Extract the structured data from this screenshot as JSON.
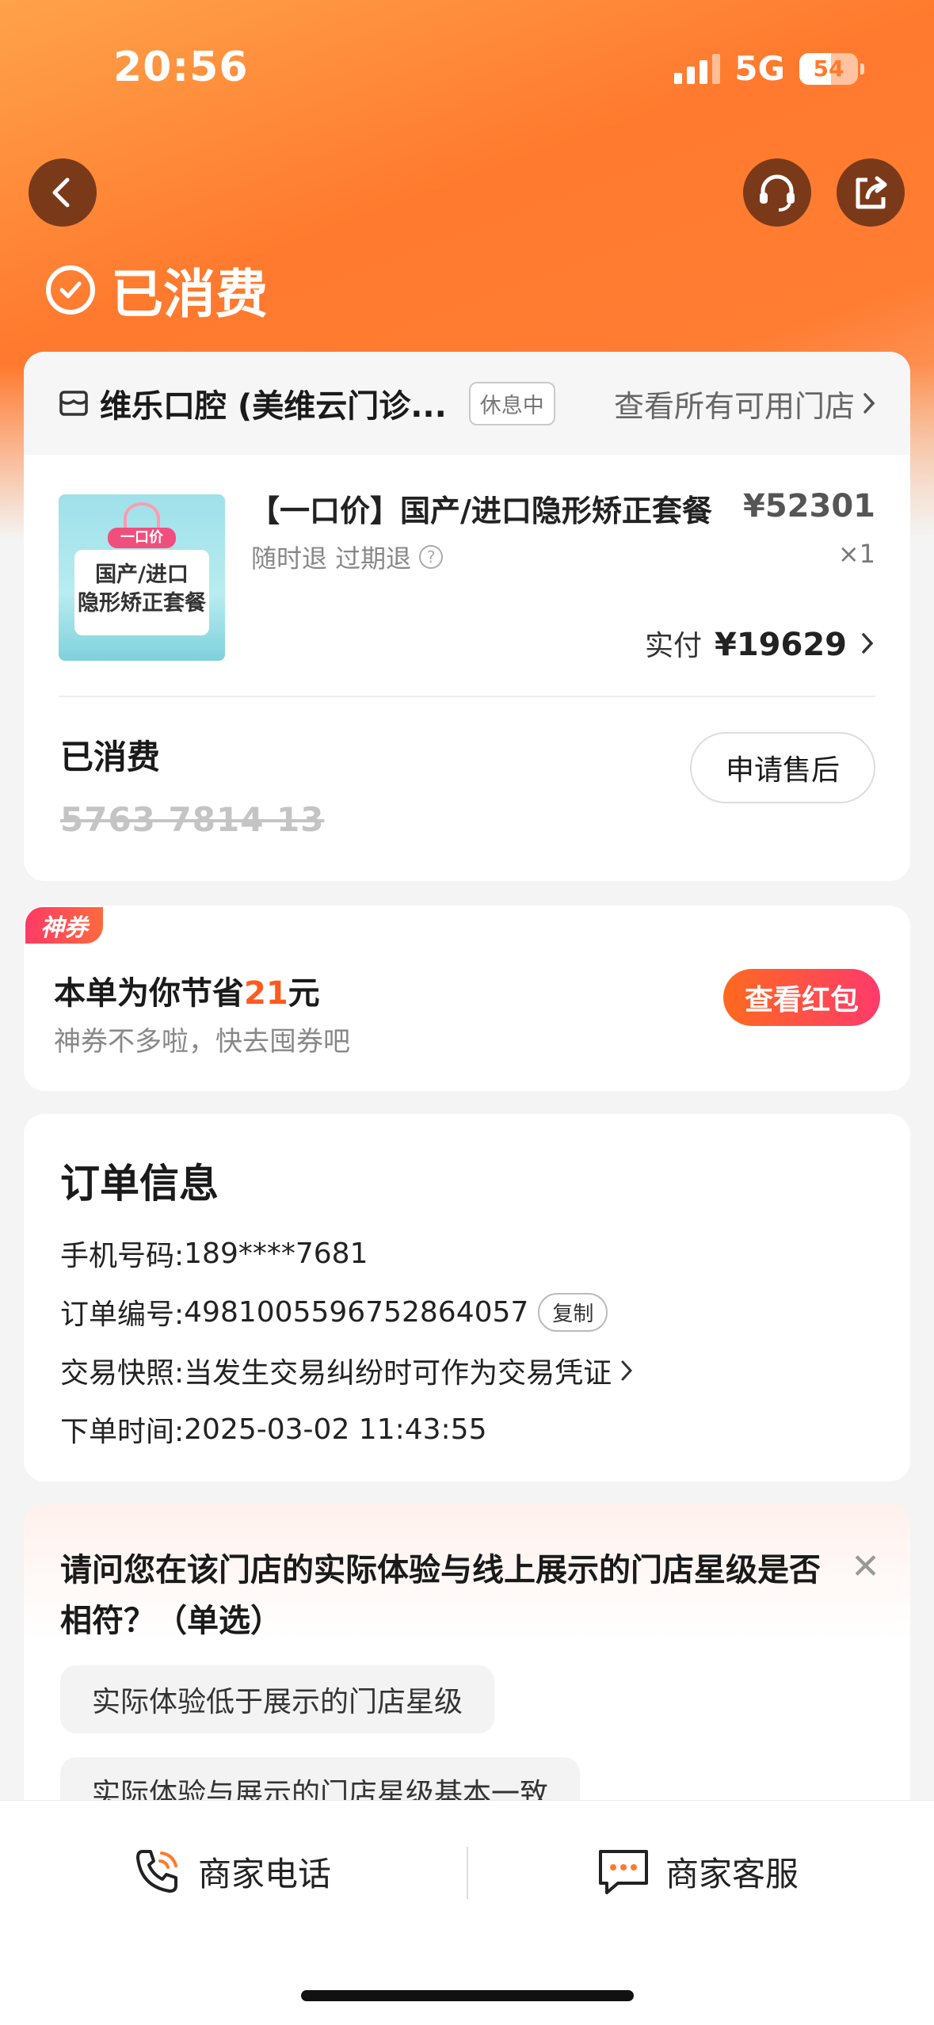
{
  "status_bar": {
    "time": "20:56",
    "network": "5G",
    "battery": "54"
  },
  "header": {
    "status_title": "已消费"
  },
  "store": {
    "name": "维乐口腔 (美维云门诊...",
    "badge": "休息中",
    "link": "查看所有可用门店"
  },
  "product": {
    "thumb_tag": "一口价",
    "thumb_line1": "国产/进口",
    "thumb_line2": "隐形矫正套餐",
    "title": "【一口价】国产/进口隐形矫正套餐",
    "price": "¥52301",
    "sub": "随时退 过期退",
    "qty": "×1",
    "paid_label": "实付",
    "paid_amount": "¥19629"
  },
  "voucher": {
    "label": "已消费",
    "code": "5763 7814 13",
    "after_sale": "申请售后"
  },
  "coupon": {
    "tag": "神券",
    "main_prefix": "本单为你节省",
    "main_amount": "21",
    "main_suffix": "元",
    "sub": "神券不多啦，快去囤券吧",
    "button": "查看红包"
  },
  "order_info": {
    "title": "订单信息",
    "phone_label": "手机号码:",
    "phone": "189****7681",
    "order_no_label": "订单编号:",
    "order_no": "4981005596752864057",
    "copy": "复制",
    "snapshot_label": "交易快照:",
    "snapshot": "当发生交易纠纷时可作为交易凭证",
    "time_label": "下单时间:",
    "time": "2025-03-02 11:43:55"
  },
  "survey": {
    "question": "请问您在该门店的实际体验与线上展示的门店星级是否相符？（单选）",
    "options": [
      "实际体验低于展示的门店星级",
      "实际体验与展示的门店星级基本一致"
    ]
  },
  "bottom_bar": {
    "phone": "商家电话",
    "service": "商家客服"
  },
  "colors": {
    "accent": "#ff7a2e",
    "highlight": "#ff5a1f"
  }
}
